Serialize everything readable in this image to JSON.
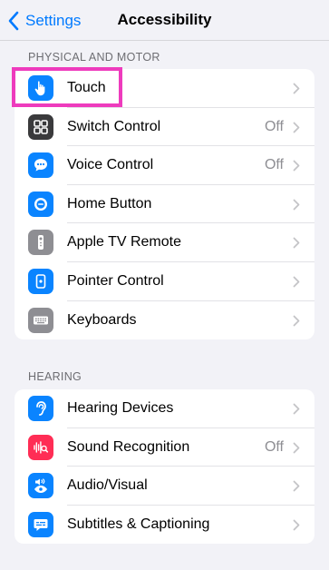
{
  "nav": {
    "back_label": "Settings",
    "title": "Accessibility"
  },
  "sections": {
    "physical_header": "PHYSICAL AND MOTOR",
    "hearing_header": "HEARING"
  },
  "physical_items": [
    {
      "label": "Touch",
      "value": "",
      "icon": "hand-point-icon",
      "color": "#0a84ff"
    },
    {
      "label": "Switch Control",
      "value": "Off",
      "icon": "switch-grid-icon",
      "color": "#3a3a3c"
    },
    {
      "label": "Voice Control",
      "value": "Off",
      "icon": "voice-bubble-icon",
      "color": "#0a84ff"
    },
    {
      "label": "Home Button",
      "value": "",
      "icon": "home-button-icon",
      "color": "#0a84ff"
    },
    {
      "label": "Apple TV Remote",
      "value": "",
      "icon": "tv-remote-icon",
      "color": "#8e8e93"
    },
    {
      "label": "Pointer Control",
      "value": "",
      "icon": "pointer-icon",
      "color": "#0a84ff"
    },
    {
      "label": "Keyboards",
      "value": "",
      "icon": "keyboard-icon",
      "color": "#8e8e93"
    }
  ],
  "hearing_items": [
    {
      "label": "Hearing Devices",
      "value": "",
      "icon": "ear-icon",
      "color": "#0a84ff"
    },
    {
      "label": "Sound Recognition",
      "value": "Off",
      "icon": "sound-wave-icon",
      "color": "#ff2d55"
    },
    {
      "label": "Audio/Visual",
      "value": "",
      "icon": "speaker-eye-icon",
      "color": "#0a84ff"
    },
    {
      "label": "Subtitles & Captioning",
      "value": "",
      "icon": "captions-icon",
      "color": "#0a84ff"
    }
  ],
  "colors": {
    "accent": "#007aff",
    "highlight": "#ee3bbd",
    "background": "#f2f2f7"
  }
}
